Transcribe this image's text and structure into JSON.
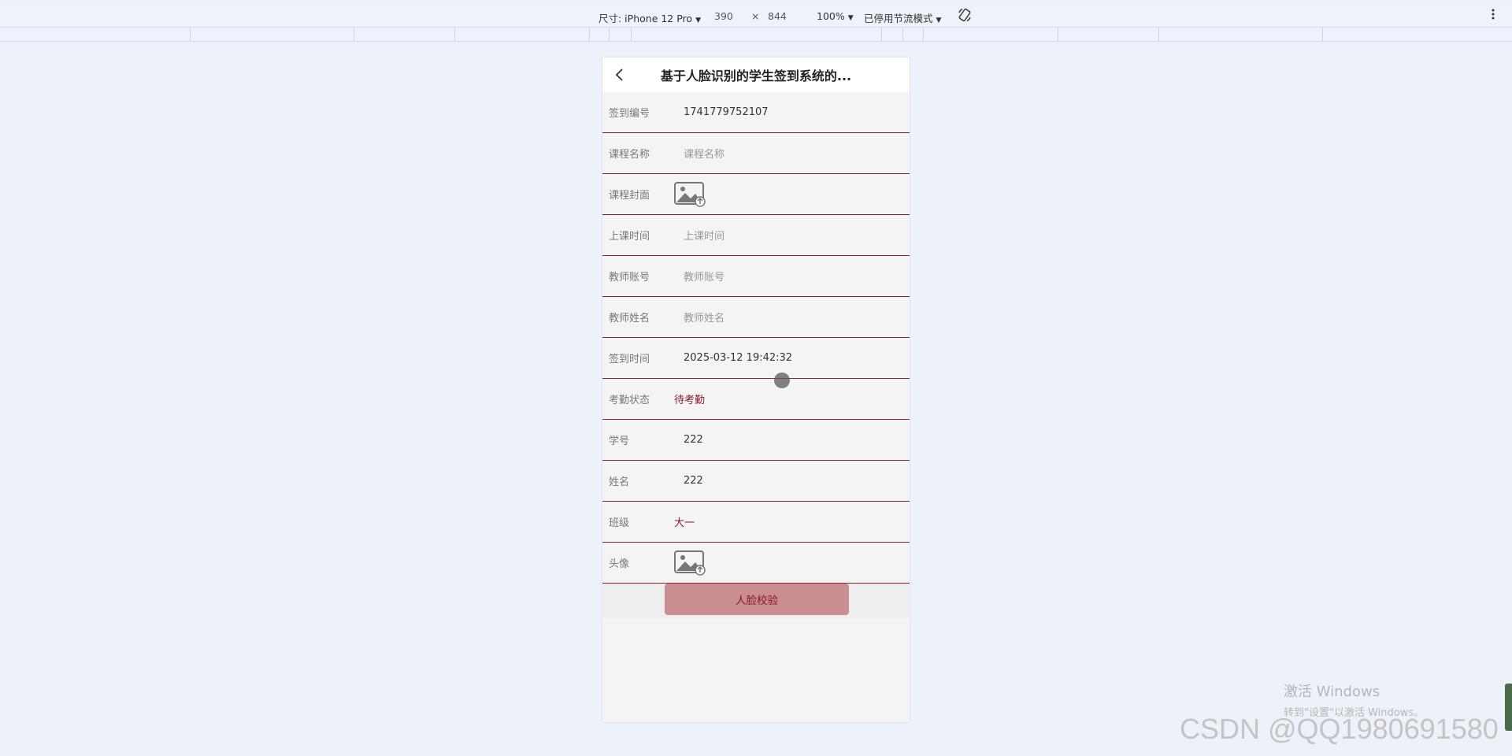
{
  "devtools": {
    "size_label": "尺寸: iPhone 12 Pro",
    "width": "390",
    "times": "×",
    "height": "844",
    "zoom": "100%",
    "throttle": "已停用节流模式",
    "rotate_icon": "rotate-icon",
    "more_icon": "more-vertical-icon"
  },
  "page": {
    "title": "基于人脸识别的学生签到系统的...",
    "back_icon": "back-arrow-icon"
  },
  "form": {
    "sign_id": {
      "label": "签到编号",
      "value": "1741779752107"
    },
    "course_name": {
      "label": "课程名称",
      "placeholder": "课程名称"
    },
    "course_cover": {
      "label": "课程封面",
      "icon": "image-placeholder-icon"
    },
    "class_time": {
      "label": "上课时间",
      "placeholder": "上课时间"
    },
    "teacher_account": {
      "label": "教师账号",
      "placeholder": "教师账号"
    },
    "teacher_name": {
      "label": "教师姓名",
      "placeholder": "教师姓名"
    },
    "sign_time": {
      "label": "签到时间",
      "value": "2025-03-12 19:42:32"
    },
    "attendance_status": {
      "label": "考勤状态",
      "value": "待考勤"
    },
    "student_no": {
      "label": "学号",
      "value": "222"
    },
    "name": {
      "label": "姓名",
      "value": "222"
    },
    "class": {
      "label": "班级",
      "value": "大一"
    },
    "avatar": {
      "label": "头像",
      "icon": "image-placeholder-icon"
    }
  },
  "buttons": {
    "face_verify": "人脸校验"
  },
  "overlay": {
    "activate_title": "激活 Windows",
    "activate_sub": "转到\"设置\"以激活 Windows。",
    "watermark": "CSDN @QQ1980691580"
  },
  "colors": {
    "accent": "#8b1a2a",
    "button_bg": "#c98e92",
    "page_bg": "#edf1f9"
  }
}
